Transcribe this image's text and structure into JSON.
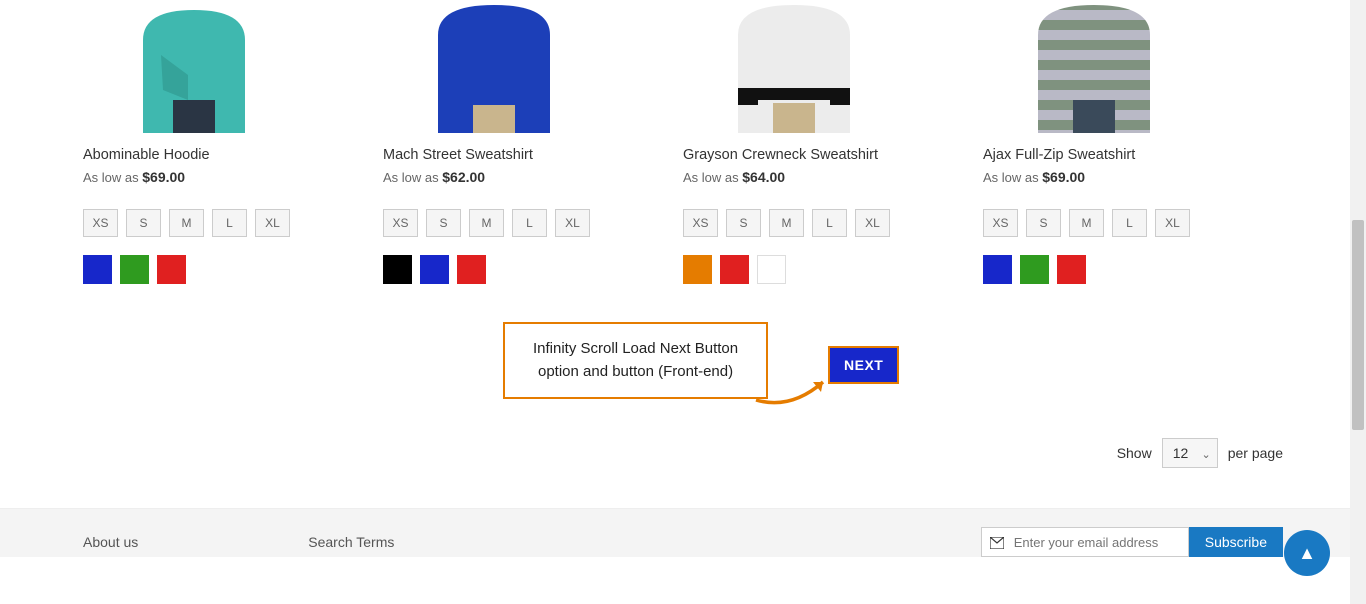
{
  "products": [
    {
      "name": "Abominable Hoodie",
      "as_low_as": "As low as",
      "price": "$69.00",
      "sizes": [
        "XS",
        "S",
        "M",
        "L",
        "XL"
      ],
      "colors": [
        "#1727ca",
        "#2f9b1f",
        "#e02020"
      ]
    },
    {
      "name": "Mach Street Sweatshirt",
      "as_low_as": "As low as",
      "price": "$62.00",
      "sizes": [
        "XS",
        "S",
        "M",
        "L",
        "XL"
      ],
      "colors": [
        "#000000",
        "#1727ca",
        "#e02020"
      ]
    },
    {
      "name": "Grayson Crewneck Sweatshirt",
      "as_low_as": "As low as",
      "price": "$64.00",
      "sizes": [
        "XS",
        "S",
        "M",
        "L",
        "XL"
      ],
      "colors": [
        "#e57c00",
        "#e02020",
        "#ffffff"
      ]
    },
    {
      "name": "Ajax Full-Zip Sweatshirt",
      "as_low_as": "As low as",
      "price": "$69.00",
      "sizes": [
        "XS",
        "S",
        "M",
        "L",
        "XL"
      ],
      "colors": [
        "#1727ca",
        "#2f9b1f",
        "#e02020"
      ]
    }
  ],
  "annotation": {
    "line1": "Infinity Scroll Load Next Button",
    "line2": "option and button (Front-end)"
  },
  "next_button": "NEXT",
  "toolbar": {
    "show_label": "Show",
    "per_page_label": "per page",
    "limit_value": "12"
  },
  "footer": {
    "about": "About us",
    "search_terms": "Search Terms",
    "newsletter_placeholder": "Enter your email address",
    "subscribe": "Subscribe"
  }
}
